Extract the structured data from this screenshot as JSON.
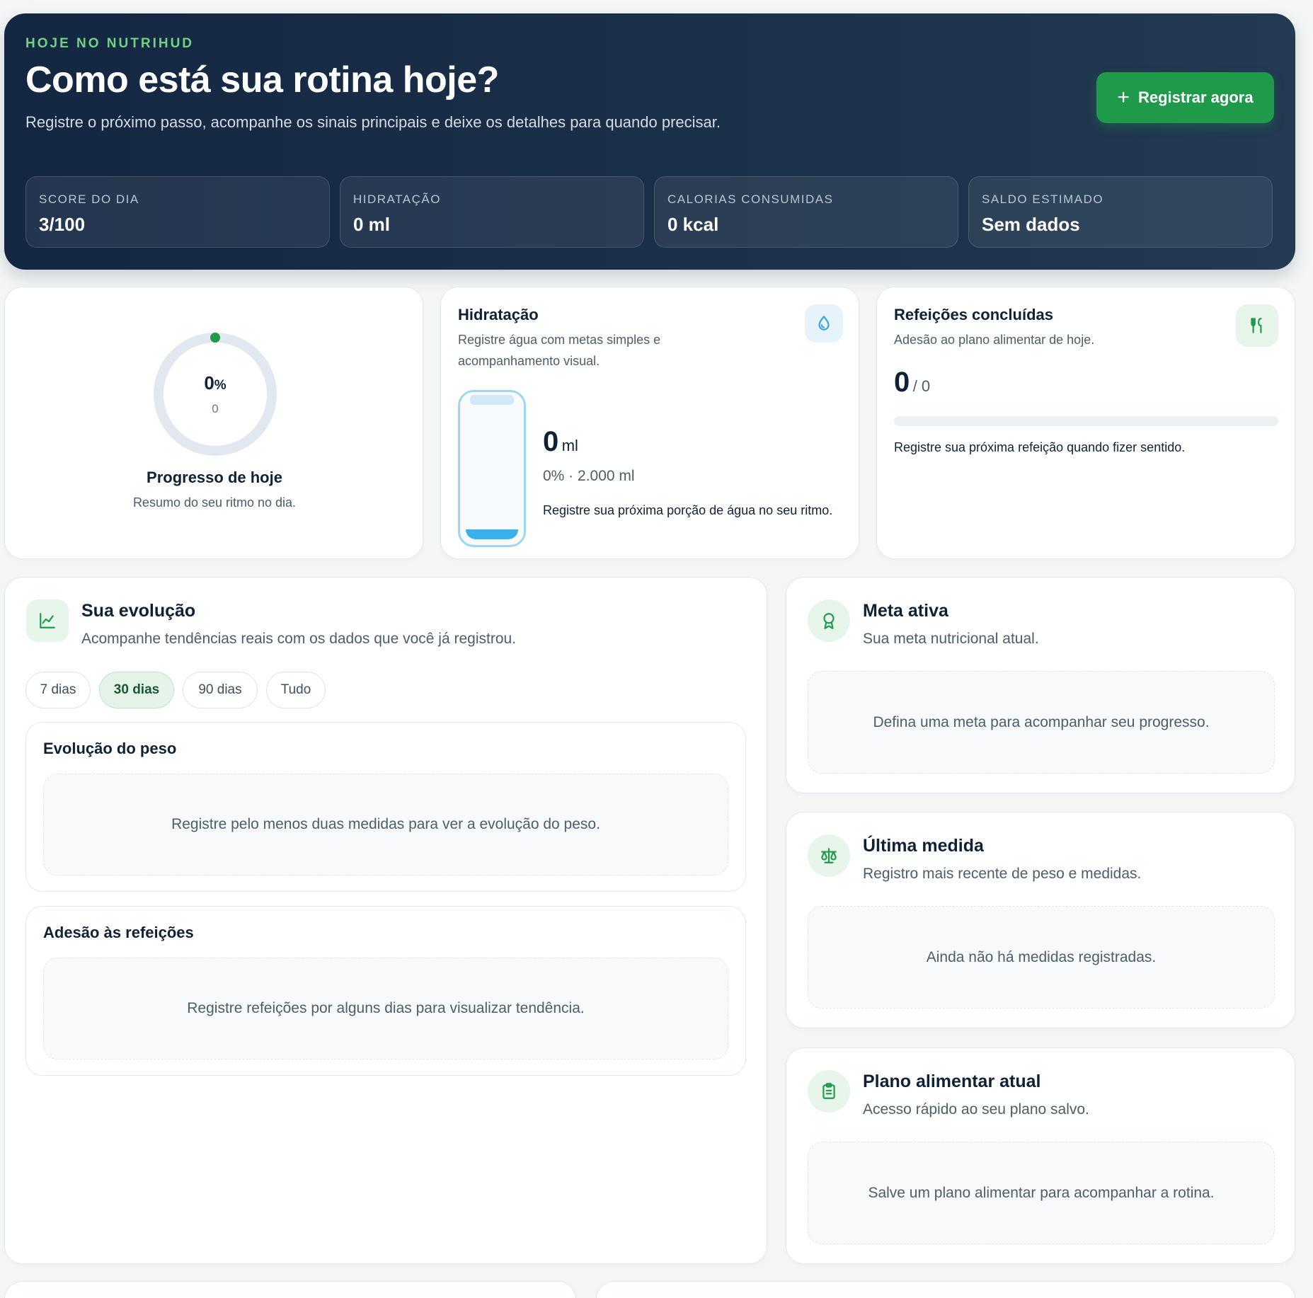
{
  "hero": {
    "eyebrow": "HOJE NO NUTRIHUD",
    "title": "Como está sua rotina hoje?",
    "subtitle": "Registre o próximo passo, acompanhe os sinais principais e deixe os detalhes para quando precisar.",
    "cta_label": "Registrar agora",
    "stats": [
      {
        "label": "SCORE DO DIA",
        "value": "3/100"
      },
      {
        "label": "HIDRATAÇÃO",
        "value": "0 ml"
      },
      {
        "label": "CALORIAS CONSUMIDAS",
        "value": "0 kcal"
      },
      {
        "label": "SALDO ESTIMADO",
        "value": "Sem dados"
      }
    ]
  },
  "progress": {
    "percent": "0",
    "percent_unit": "%",
    "count": "0",
    "title": "Progresso de hoje",
    "subtitle": "Resumo do seu ritmo no dia.",
    "fraction": 0
  },
  "hydration": {
    "title": "Hidratação",
    "subtitle": "Registre água com metas simples e acompanhamento visual.",
    "amount": "0",
    "unit": "ml",
    "detail": "0% · 2.000 ml",
    "hint": "Registre sua próxima porção de água no seu ritmo.",
    "fill_fraction": 0,
    "icon": "droplet-icon"
  },
  "meals": {
    "title": "Refeições concluídas",
    "subtitle": "Adesão ao plano alimentar de hoje.",
    "done": "0",
    "total": "/ 0",
    "hint": "Registre sua próxima refeição quando fizer sentido.",
    "fill_fraction": 0,
    "icon": "utensils-icon"
  },
  "evolution": {
    "title": "Sua evolução",
    "subtitle": "Acompanhe tendências reais com os dados que você já registrou.",
    "ranges": [
      "7 dias",
      "30 dias",
      "90 dias",
      "Tudo"
    ],
    "active_range": "30 dias",
    "weight": {
      "title": "Evolução do peso",
      "empty": "Registre pelo menos duas medidas para ver a evolução do peso."
    },
    "adherence": {
      "title": "Adesão às refeições",
      "empty": "Registre refeições por alguns dias para visualizar tendência."
    }
  },
  "goal": {
    "title": "Meta ativa",
    "subtitle": "Sua meta nutricional atual.",
    "empty": "Defina uma meta para acompanhar seu progresso."
  },
  "measure": {
    "title": "Última medida",
    "subtitle": "Registro mais recente de peso e medidas.",
    "empty": "Ainda não há medidas registradas."
  },
  "plan": {
    "title": "Plano alimentar atual",
    "subtitle": "Acesso rápido ao seu plano salvo.",
    "empty": "Salve um plano alimentar para acompanhar a rotina."
  },
  "colors": {
    "hero_bg": "#142742",
    "accent_green": "#1f9a4b",
    "eyebrow_green": "#6fd37f",
    "water_blue": "#3bb0ea"
  }
}
